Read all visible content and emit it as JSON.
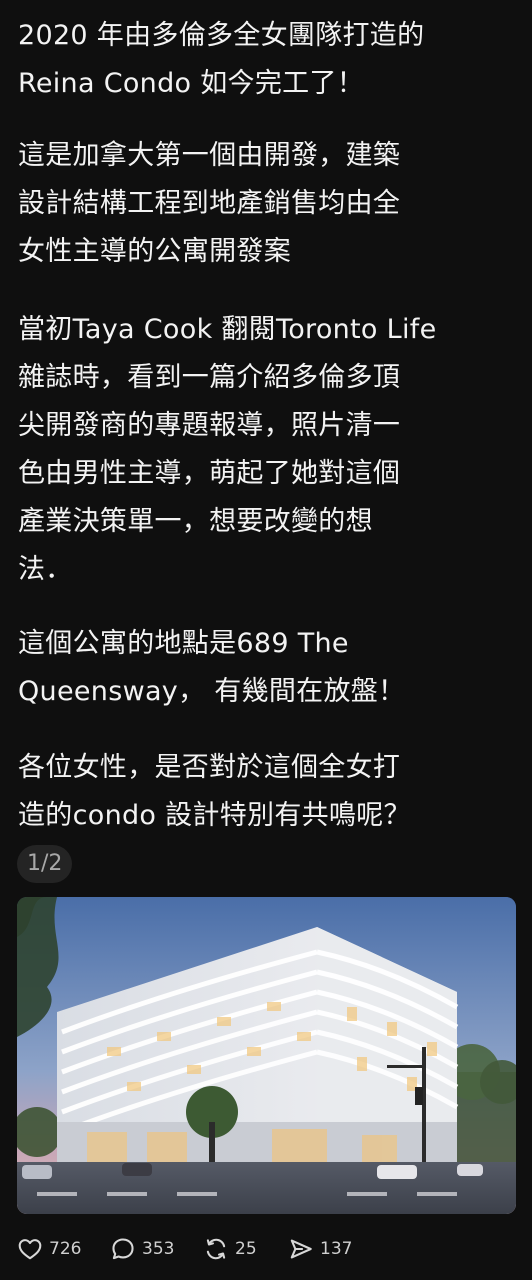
{
  "post": {
    "paragraphs": [
      "2020 年由多倫多全女團隊打造的\nReina Condo 如今完工了！",
      "這是加拿大第一個由開發，建築\n設計結構工程到地產銷售均由全\n女性主導的公寓開發案",
      "當初Taya Cook 翻閱Toronto Life\n雜誌時，看到一篇介紹多倫多頂\n尖開發商的專題報導，照片清一\n色由男性主導，萌起了她對這個\n產業決策單一，想要改變的想\n法．",
      "這個公寓的地點是689 The\nQueensway， 有幾間在放盤！",
      "各位女性，是否對於這個全女打\n造的condo 設計特別有共鳴呢？"
    ],
    "image_counter": "1/2",
    "image": {
      "icon": "condo-building-photo"
    }
  },
  "actions": {
    "likes": "726",
    "comments": "353",
    "reposts": "25",
    "shares": "137"
  },
  "colors": {
    "background": "#0f0f0f",
    "text": "#f3f3f3",
    "muted": "#a8a8a8",
    "badge_bg": "#242424"
  }
}
